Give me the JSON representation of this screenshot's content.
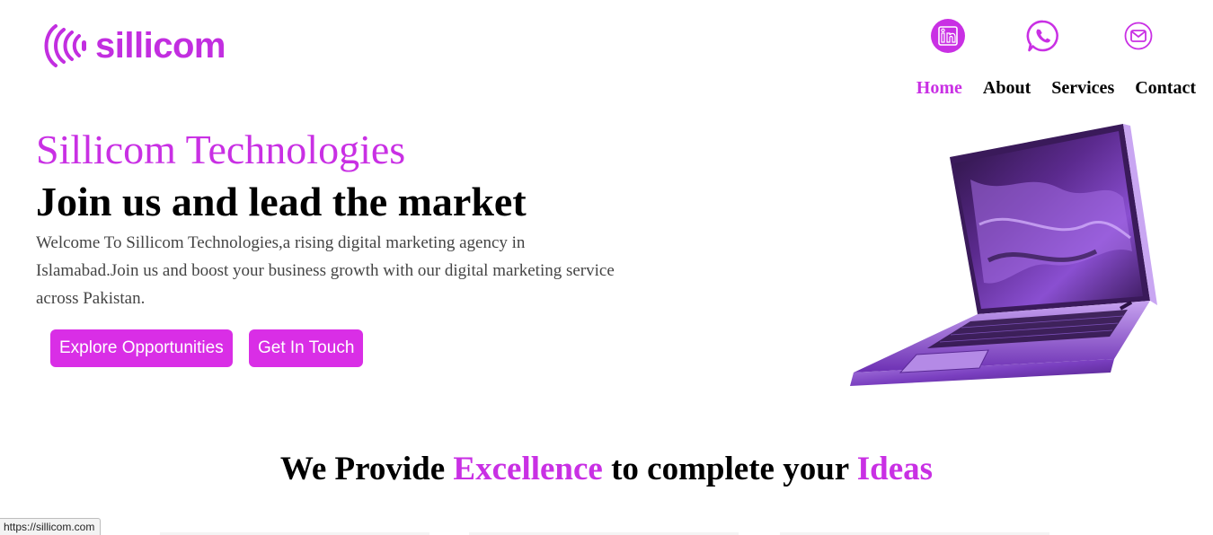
{
  "brand": {
    "name": "sillicom",
    "color": "#c930e4"
  },
  "social": [
    {
      "name": "linkedin-icon"
    },
    {
      "name": "whatsapp-icon"
    },
    {
      "name": "mail-icon"
    }
  ],
  "nav": {
    "home": "Home",
    "about": "About",
    "services": "Services",
    "contact": "Contact"
  },
  "hero": {
    "brand_title": "Sillicom Technologies",
    "headline": "Join us and lead the market",
    "description": "Welcome To Sillicom Technologies,a rising digital marketing agency in Islamabad.Join us and boost your business growth with our digital marketing service across Pakistan.",
    "explore_label": "Explore Opportunities",
    "touch_label": "Get In Touch",
    "button_color": "#d92ee6"
  },
  "tagline": {
    "part1": "We Provide ",
    "highlight1": "Excellence",
    "part2": " to complete your ",
    "highlight2": "Ideas"
  },
  "status_bar": {
    "url": "https://sillicom.com"
  }
}
